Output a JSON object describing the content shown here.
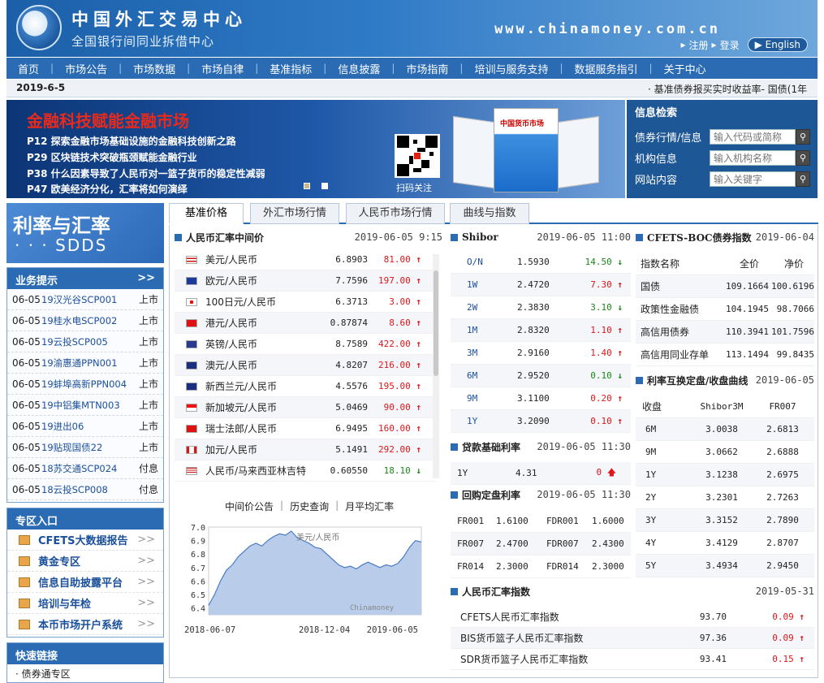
{
  "header": {
    "logo_cn": "中国外汇交易中心",
    "logo_sub": "全国银行间同业拆借中心",
    "url": "www.chinamoney.com.cn",
    "register": "注册",
    "login": "登录",
    "english": "English"
  },
  "nav": [
    "首页",
    "市场公告",
    "市场数据",
    "市场自律",
    "基准指标",
    "信息披露",
    "市场指南",
    "培训与服务支持",
    "数据服务指引",
    "关于中心"
  ],
  "datebar": {
    "date": "2019-6-5",
    "ticker": "· 基准债券报买实时收益率-    国债(1年"
  },
  "banner": {
    "title": "金融科技赋能金融市场",
    "lines": [
      "P12  探索金融市场基础设施的金融科技创新之路",
      "P29  区块链技术突破瓶颈赋能金融行业",
      "P38  什么因素导致了人民币对一篮子货币的稳定性减弱",
      "P47  欧美经济分化，汇率将如何演绎"
    ],
    "qr_label": "扫码关注",
    "magazine_title": "中国货币市场"
  },
  "search": {
    "title": "信息检索",
    "rows": [
      {
        "label": "债券行情/信息",
        "placeholder": "输入代码或简称"
      },
      {
        "label": "机构信息",
        "placeholder": "输入机构名称"
      },
      {
        "label": "网站内容",
        "placeholder": "输入关键字"
      }
    ]
  },
  "sdds": {
    "t1": "利率与汇率",
    "t2": "· · · SDDS"
  },
  "business": {
    "title": "业务提示",
    "more": ">>",
    "rows": [
      {
        "date": "06-05",
        "name": "19汉光谷SCP001",
        "status": "上市"
      },
      {
        "date": "06-05",
        "name": "19桂水电SCP002",
        "status": "上市"
      },
      {
        "date": "06-05",
        "name": "19云投SCP005",
        "status": "上市"
      },
      {
        "date": "06-05",
        "name": "19渝惠通PPN001",
        "status": "上市"
      },
      {
        "date": "06-05",
        "name": "19蚌埠高新PPN004",
        "status": "上市"
      },
      {
        "date": "06-05",
        "name": "19中铝集MTN003",
        "status": "上市"
      },
      {
        "date": "06-05",
        "name": "19进出06",
        "status": "上市"
      },
      {
        "date": "06-05",
        "name": "19贴现国债22",
        "status": "上市"
      },
      {
        "date": "06-05",
        "name": "18苏交通SCP024",
        "status": "付息"
      },
      {
        "date": "06-05",
        "name": "18云投SCP008",
        "status": "付息"
      }
    ]
  },
  "zone": {
    "title": "专区入口",
    "rows": [
      "CFETS大数据报告",
      "黄金专区",
      "信息自助披露平台",
      "培训与年检",
      "本币市场开户系统"
    ],
    "arrow": ">>"
  },
  "quick": {
    "title": "快速链接",
    "first": "债券通专区"
  },
  "tabs": [
    "基准价格",
    "外汇市场行情",
    "人民币市场行情",
    "曲线与指数"
  ],
  "fx": {
    "title": "人民币汇率中间价",
    "stamp": "2019-06-05 9:15",
    "rows": [
      {
        "name": "美元/人民币",
        "value": "6.8903",
        "change": "81.00",
        "dir": "up",
        "flag": "us"
      },
      {
        "name": "欧元/人民币",
        "value": "7.7596",
        "change": "197.00",
        "dir": "up",
        "flag": "eu"
      },
      {
        "name": "100日元/人民币",
        "value": "6.3713",
        "change": "3.00",
        "dir": "up",
        "flag": "jp"
      },
      {
        "name": "港元/人民币",
        "value": "0.87874",
        "change": "8.60",
        "dir": "up",
        "flag": "hk"
      },
      {
        "name": "英镑/人民币",
        "value": "8.7589",
        "change": "422.00",
        "dir": "up",
        "flag": "gb"
      },
      {
        "name": "澳元/人民币",
        "value": "4.8207",
        "change": "216.00",
        "dir": "up",
        "flag": "au"
      },
      {
        "name": "新西兰元/人民币",
        "value": "4.5576",
        "change": "195.00",
        "dir": "up",
        "flag": "nz"
      },
      {
        "name": "新加坡元/人民币",
        "value": "5.0469",
        "change": "90.00",
        "dir": "up",
        "flag": "sg"
      },
      {
        "name": "瑞士法郎/人民币",
        "value": "6.9495",
        "change": "160.00",
        "dir": "up",
        "flag": "ch"
      },
      {
        "name": "加元/人民币",
        "value": "5.1491",
        "change": "292.00",
        "dir": "up",
        "flag": "ca"
      },
      {
        "name": "人民币/马来西亚林吉特",
        "value": "0.60550",
        "change": "18.10",
        "dir": "dn",
        "flag": "my"
      }
    ],
    "chart_links": [
      "中间价公告",
      "历史查询",
      "月平均汇率"
    ]
  },
  "chart_data": {
    "type": "area",
    "series": [
      {
        "name": "美元/人民币",
        "values": [
          6.42,
          6.5,
          6.6,
          6.68,
          6.72,
          6.78,
          6.82,
          6.86,
          6.88,
          6.86,
          6.9,
          6.93,
          6.95,
          6.94,
          6.97,
          6.92,
          6.9,
          6.88,
          6.85,
          6.84,
          6.8,
          6.76,
          6.72,
          6.7,
          6.71,
          6.69,
          6.72,
          6.74,
          6.72,
          6.7,
          6.72,
          6.71,
          6.73,
          6.78,
          6.85,
          6.9,
          6.89
        ]
      }
    ],
    "x_ticks": [
      "2018-06-07",
      "2018-12-04",
      "2019-06-05"
    ],
    "y_ticks": [
      "7.0",
      "6.9",
      "6.8",
      "6.7",
      "6.6",
      "6.5",
      "6.4"
    ],
    "ylim": [
      6.35,
      7.0
    ],
    "watermark": "Chinamoney"
  },
  "shibor": {
    "title": "Shibor",
    "stamp": "2019-06-05 11:00",
    "rows": [
      {
        "term": "O/N",
        "value": "1.5930",
        "change": "14.50",
        "dir": "dn"
      },
      {
        "term": "1W",
        "value": "2.4720",
        "change": "7.30",
        "dir": "up"
      },
      {
        "term": "2W",
        "value": "2.3830",
        "change": "3.10",
        "dir": "dn"
      },
      {
        "term": "1M",
        "value": "2.8320",
        "change": "1.10",
        "dir": "up"
      },
      {
        "term": "3M",
        "value": "2.9160",
        "change": "1.40",
        "dir": "up"
      },
      {
        "term": "6M",
        "value": "2.9520",
        "change": "0.10",
        "dir": "dn"
      },
      {
        "term": "9M",
        "value": "3.1100",
        "change": "0.20",
        "dir": "up"
      },
      {
        "term": "1Y",
        "value": "3.2090",
        "change": "0.10",
        "dir": "up"
      }
    ]
  },
  "lpr": {
    "title": "贷款基础利率",
    "stamp": "2019-06-05 11:30",
    "term": "1Y",
    "value": "4.31",
    "change": "0"
  },
  "repo": {
    "title": "回购定盘利率",
    "stamp": "2019-06-05 11:30",
    "rows": [
      {
        "a": "FR001",
        "av": "1.6100",
        "b": "FDR001",
        "bv": "1.6000"
      },
      {
        "a": "FR007",
        "av": "2.4700",
        "b": "FDR007",
        "bv": "2.4300"
      },
      {
        "a": "FR014",
        "av": "2.3000",
        "b": "FDR014",
        "bv": "2.3000"
      }
    ]
  },
  "boc": {
    "title": "CFETS-BOC债券指数",
    "stamp": "2019-06-04",
    "headers": [
      "指数名称",
      "全价",
      "净价"
    ],
    "rows": [
      {
        "name": "国债",
        "full": "109.1664",
        "net": "100.6196"
      },
      {
        "name": "政策性金融债",
        "full": "104.1945",
        "net": "98.7066"
      },
      {
        "name": "高信用债券",
        "full": "110.3941",
        "net": "101.7596"
      },
      {
        "name": "高信用同业存单",
        "full": "113.1494",
        "net": "99.8435"
      }
    ]
  },
  "swap": {
    "title": "利率互换定盘/收盘曲线",
    "stamp": "2019-06-05",
    "headers": [
      "收盘",
      "Shibor3M",
      "FR007"
    ],
    "rows": [
      {
        "t": "6M",
        "s": "3.0038",
        "f": "2.6813"
      },
      {
        "t": "9M",
        "s": "3.0662",
        "f": "2.6888"
      },
      {
        "t": "1Y",
        "s": "3.1238",
        "f": "2.6975"
      },
      {
        "t": "2Y",
        "s": "3.2301",
        "f": "2.7263"
      },
      {
        "t": "3Y",
        "s": "3.3152",
        "f": "2.7890"
      },
      {
        "t": "4Y",
        "s": "3.4129",
        "f": "2.8707"
      },
      {
        "t": "5Y",
        "s": "3.4934",
        "f": "2.9450"
      }
    ]
  },
  "rmbi": {
    "title": "人民币汇率指数",
    "stamp": "2019-05-31",
    "rows": [
      {
        "name": "CFETS人民币汇率指数",
        "value": "93.70",
        "change": "0.09"
      },
      {
        "name": "BIS货币篮子人民币汇率指数",
        "value": "97.36",
        "change": "0.09"
      },
      {
        "name": "SDR货币篮子人民币汇率指数",
        "value": "93.41",
        "change": "0.15"
      }
    ]
  }
}
